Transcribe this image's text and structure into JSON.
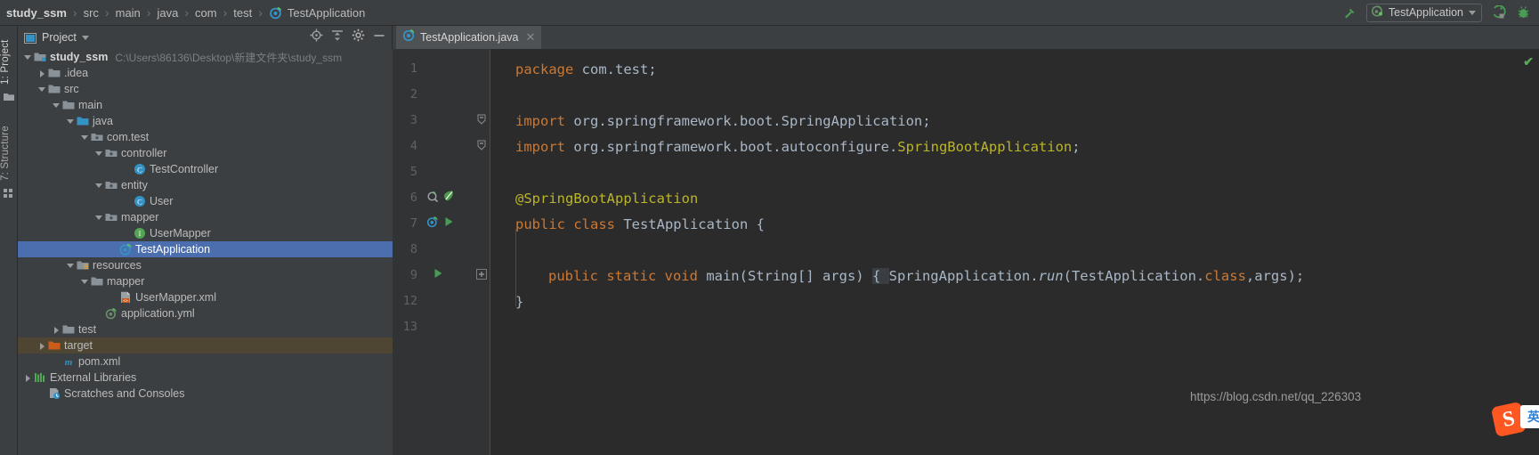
{
  "breadcrumb": {
    "items": [
      {
        "label": "study_ssm",
        "icon": "none"
      },
      {
        "label": "src",
        "icon": "none"
      },
      {
        "label": "main",
        "icon": "none"
      },
      {
        "label": "java",
        "icon": "none"
      },
      {
        "label": "com",
        "icon": "none"
      },
      {
        "label": "test",
        "icon": "none"
      },
      {
        "label": "TestApplication",
        "icon": "spring-class-icon"
      }
    ],
    "separator": "›"
  },
  "toolbar_right": {
    "build_icon": "hammer-icon",
    "run_config_label": "TestApplication",
    "run_config_icon": "spring-boot-icon",
    "dropdown_icon": "chevron-down-icon",
    "run_icon": "run-icon",
    "debug_icon": "debug-icon"
  },
  "tool_window_tabs": [
    {
      "label": "1: Project",
      "icon": "project-icon"
    },
    {
      "label": "7: Structure",
      "icon": "structure-icon"
    }
  ],
  "project_panel": {
    "title": "Project",
    "dropdown_icon": "chevron-down-icon",
    "icons": [
      "locate-icon",
      "collapse-all-icon",
      "settings-gear-icon",
      "hide-icon"
    ],
    "tree": [
      {
        "label": "study_ssm",
        "path": "C:\\Users\\86136\\Desktop\\新建文件夹\\study_ssm",
        "depth": 0,
        "arrow": "open",
        "icon": "module-icon",
        "bold": true,
        "state": "normal"
      },
      {
        "label": ".idea",
        "path": "",
        "depth": 1,
        "arrow": "closed",
        "icon": "folder-icon",
        "bold": false,
        "state": "normal"
      },
      {
        "label": "src",
        "path": "",
        "depth": 1,
        "arrow": "open",
        "icon": "folder-icon",
        "bold": false,
        "state": "normal"
      },
      {
        "label": "main",
        "path": "",
        "depth": 2,
        "arrow": "open",
        "icon": "folder-icon",
        "bold": false,
        "state": "normal"
      },
      {
        "label": "java",
        "path": "",
        "depth": 3,
        "arrow": "open",
        "icon": "source-root-icon",
        "bold": false,
        "state": "normal"
      },
      {
        "label": "com.test",
        "path": "",
        "depth": 4,
        "arrow": "open",
        "icon": "package-icon",
        "bold": false,
        "state": "normal"
      },
      {
        "label": "controller",
        "path": "",
        "depth": 5,
        "arrow": "open",
        "icon": "package-icon",
        "bold": false,
        "state": "normal"
      },
      {
        "label": "TestController",
        "path": "",
        "depth": 7,
        "arrow": "none",
        "icon": "java-class-icon",
        "bold": false,
        "state": "normal"
      },
      {
        "label": "entity",
        "path": "",
        "depth": 5,
        "arrow": "open",
        "icon": "package-icon",
        "bold": false,
        "state": "normal"
      },
      {
        "label": "User",
        "path": "",
        "depth": 7,
        "arrow": "none",
        "icon": "java-class-icon",
        "bold": false,
        "state": "normal"
      },
      {
        "label": "mapper",
        "path": "",
        "depth": 5,
        "arrow": "open",
        "icon": "package-icon",
        "bold": false,
        "state": "normal"
      },
      {
        "label": "UserMapper",
        "path": "",
        "depth": 7,
        "arrow": "none",
        "icon": "java-interface-icon",
        "bold": false,
        "state": "normal"
      },
      {
        "label": "TestApplication",
        "path": "",
        "depth": 6,
        "arrow": "none",
        "icon": "spring-class-icon",
        "bold": false,
        "state": "selected"
      },
      {
        "label": "resources",
        "path": "",
        "depth": 3,
        "arrow": "open",
        "icon": "resource-root-icon",
        "bold": false,
        "state": "normal"
      },
      {
        "label": "mapper",
        "path": "",
        "depth": 4,
        "arrow": "open",
        "icon": "folder-icon",
        "bold": false,
        "state": "normal"
      },
      {
        "label": "UserMapper.xml",
        "path": "",
        "depth": 6,
        "arrow": "none",
        "icon": "xml-file-icon",
        "bold": false,
        "state": "normal"
      },
      {
        "label": "application.yml",
        "path": "",
        "depth": 5,
        "arrow": "none",
        "icon": "spring-yaml-icon",
        "bold": false,
        "state": "normal"
      },
      {
        "label": "test",
        "path": "",
        "depth": 2,
        "arrow": "closed",
        "icon": "folder-icon",
        "bold": false,
        "state": "normal"
      },
      {
        "label": "target",
        "path": "",
        "depth": 1,
        "arrow": "closed",
        "icon": "excluded-folder-icon",
        "bold": false,
        "state": "context"
      },
      {
        "label": "pom.xml",
        "path": "",
        "depth": 2,
        "arrow": "none",
        "icon": "maven-icon",
        "bold": false,
        "state": "normal"
      },
      {
        "label": "External Libraries",
        "path": "",
        "depth": 0,
        "arrow": "closed",
        "icon": "libraries-icon",
        "bold": false,
        "state": "normal"
      },
      {
        "label": "Scratches and Consoles",
        "path": "",
        "depth": 1,
        "arrow": "none",
        "icon": "scratches-icon",
        "bold": false,
        "state": "normal"
      }
    ]
  },
  "editor": {
    "tab": {
      "label": "TestApplication.java",
      "icon": "spring-class-icon",
      "close_icon": "close-icon"
    },
    "inspection_status": "✔",
    "line_numbers": [
      "1",
      "2",
      "3",
      "4",
      "5",
      "6",
      "7",
      "8",
      "9",
      "12",
      "13"
    ],
    "lines": [
      {
        "num": "1",
        "indent": 0,
        "tokens": [
          {
            "t": "package",
            "c": "kw"
          },
          {
            "t": " com.test;",
            "c": "cls"
          }
        ]
      },
      {
        "num": "2",
        "indent": 0,
        "tokens": []
      },
      {
        "num": "3",
        "indent": 0,
        "tokens": [
          {
            "t": "import",
            "c": "kw"
          },
          {
            "t": " org.springframework.boot.SpringApplication;",
            "c": "cls"
          }
        ]
      },
      {
        "num": "4",
        "indent": 0,
        "tokens": [
          {
            "t": "import",
            "c": "kw"
          },
          {
            "t": " org.springframework.boot.autoconfigure.",
            "c": "cls"
          },
          {
            "t": "SpringBootApplication",
            "c": "hl"
          },
          {
            "t": ";",
            "c": "cls"
          }
        ]
      },
      {
        "num": "5",
        "indent": 0,
        "tokens": []
      },
      {
        "num": "6",
        "indent": 0,
        "tokens": [
          {
            "t": "@SpringBootApplication",
            "c": "ann"
          }
        ]
      },
      {
        "num": "7",
        "indent": 0,
        "tokens": [
          {
            "t": "public class",
            "c": "kw"
          },
          {
            "t": " TestApplication {",
            "c": "cls"
          }
        ]
      },
      {
        "num": "8",
        "indent": 0,
        "tokens": []
      },
      {
        "num": "9",
        "indent": 1,
        "tokens": [
          {
            "t": "public static void ",
            "c": "kw"
          },
          {
            "t": "main",
            "c": "cls"
          },
          {
            "t": "(String[] args) ",
            "c": "cls"
          },
          {
            "t": "{ ",
            "c": "fold"
          },
          {
            "t": "SpringApplication.",
            "c": "cls"
          },
          {
            "t": "run",
            "c": "mth"
          },
          {
            "t": "(TestApplication.",
            "c": "cls"
          },
          {
            "t": "class",
            "c": "kw"
          },
          {
            "t": ",args);",
            "c": "cls"
          }
        ]
      },
      {
        "num": "12",
        "indent": 0,
        "tokens": [
          {
            "t": "}",
            "c": "cls"
          }
        ]
      },
      {
        "num": "13",
        "indent": 0,
        "tokens": []
      }
    ],
    "gutter_icons": [
      {
        "line": 6,
        "icons": [
          "spring-bean-icon",
          "spring-leaf-icon"
        ]
      },
      {
        "line": 7,
        "icons": [
          "spring-boot-icon",
          "run-icon"
        ]
      },
      {
        "line": 9,
        "icons": [
          "run-icon"
        ]
      }
    ],
    "fold_markers": [
      {
        "line": 3,
        "type": "fold-end"
      },
      {
        "line": 4,
        "type": "fold-end"
      },
      {
        "line": 9,
        "type": "expand-plus"
      }
    ]
  },
  "watermark": {
    "text": "https://blog.csdn.net/qq_226303",
    "ime_logo": "S",
    "ime_mode": "英"
  },
  "colors": {
    "chrome": "#3c3f41",
    "editor_bg": "#2b2b2b",
    "gutter_bg": "#313335",
    "selection": "#4b6eaf",
    "context_row": "#4e4633",
    "keyword": "#cc7832",
    "annotation": "#bbb529",
    "text": "#a9b7c6",
    "accent_green": "#499c54"
  }
}
